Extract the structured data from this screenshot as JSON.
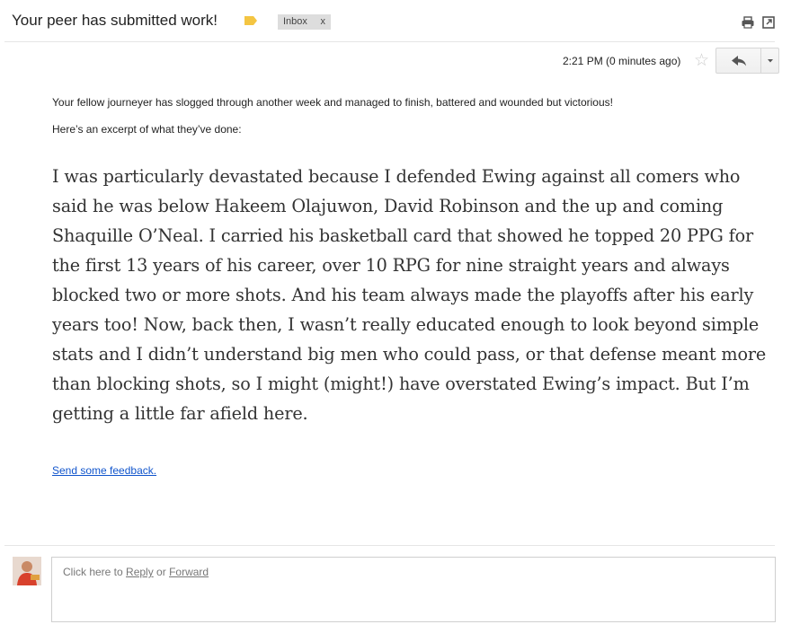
{
  "header": {
    "subject": "Your peer has submitted work!",
    "inbox_label": "Inbox",
    "inbox_remove": "x",
    "label_color": "#f4c542"
  },
  "meta": {
    "date": "2:21 PM (0 minutes ago)"
  },
  "body": {
    "intro": "Your fellow journeyer has slogged through another week and managed to finish, battered and wounded but victorious!",
    "excerpt_intro": "Here’s an excerpt of what they’ve done:",
    "excerpt": "I was particularly devastated because I defended Ewing against all comers who said he was below Hakeem Olajuwon, David Robinson and the up and coming Shaquille O’Neal. I carried his basketball card that showed he topped 20 PPG for the first 13 years of his career, over 10 RPG for nine straight years and always blocked two or more shots. And his team always made the playoffs after his early years too! Now, back then, I wasn’t really educated enough to look beyond simple stats and I didn’t understand big men who could pass, or that defense meant more than blocking shots, so I might (might!) have overstated Ewing’s impact. But I’m getting a little far afield here.",
    "feedback_link": "Send some feedback."
  },
  "reply": {
    "prefix": "Click here to ",
    "reply_link": "Reply",
    "middle": " or ",
    "forward_link": "Forward"
  },
  "icons": {
    "print": "print-icon",
    "new_window": "new-window-icon",
    "star": "star-icon",
    "reply": "reply-icon",
    "more": "chevron-down-icon",
    "label": "label-tag-icon"
  },
  "colors": {
    "link": "#1155cc",
    "chip_bg": "#dddddd"
  }
}
